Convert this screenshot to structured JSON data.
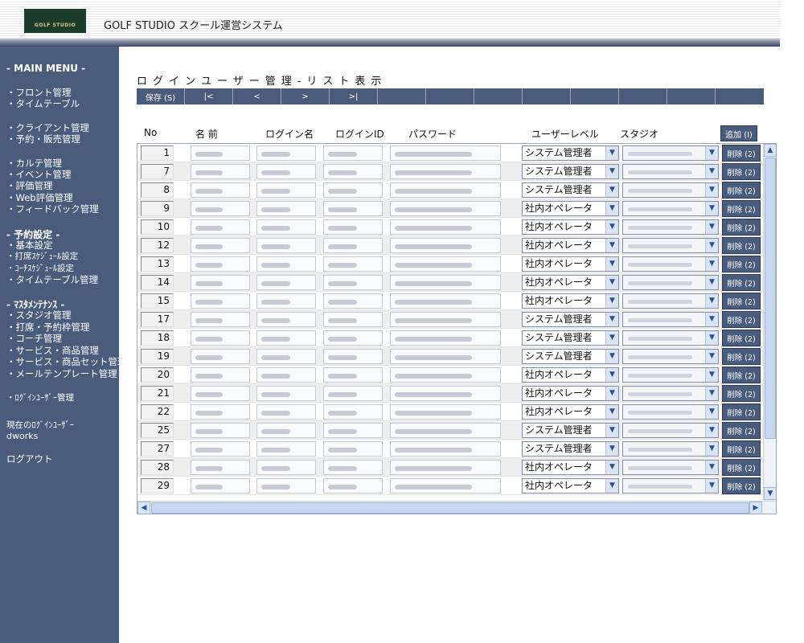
{
  "header": {
    "logo_text": "GOLF STUDIO",
    "app_title": "GOLF STUDIO スクール運営システム"
  },
  "sidebar": {
    "main_menu": "- MAIN MENU -",
    "group1": [
      "・フロント管理",
      "・タイムテーブル"
    ],
    "group2": [
      "・クライアント管理",
      "・予約・販売管理"
    ],
    "group3": [
      "・カルテ管理",
      "・イベント管理",
      "・評価管理",
      "・Web評価管理",
      "・フィードバック管理"
    ],
    "reserve_heading": "- 予約設定 -",
    "group4": [
      "・基本設定",
      "・打席ｽｹｼﾞｭｰﾙ設定",
      "・ｺｰﾁｽｹｼﾞｭｰﾙ設定",
      "・タイムテーブル管理"
    ],
    "master_heading": "- ﾏｽﾀﾒﾝﾃﾅﾝｽ -",
    "group5": [
      "・スタジオ管理",
      "・打席・予約枠管理",
      "・コーチ管理",
      "・サービス・商品管理",
      "・サービス・商品セット管理",
      "・メールテンプレート管理"
    ],
    "login_user_mgmt": "・ﾛｸﾞｲﾝﾕｰｻﾞｰ管理",
    "current_user_label": "現在のﾛｸﾞｲﾝﾕｰｻﾞｰ",
    "current_user": "dworks",
    "logout": "ログアウト"
  },
  "main": {
    "title": "ログインユーザー管理-リスト表示",
    "toolbar": {
      "save": "保存 (S)",
      "first": "|<",
      "prev": "<",
      "next": ">",
      "last": ">|"
    },
    "columns": {
      "no": "No",
      "name": "名 前",
      "login_name": "ログイン名",
      "login_id": "ログインID",
      "password": "パスワード",
      "user_level": "ユーザーレベル",
      "studio": "スタジオ"
    },
    "add_button": "追加 (I)",
    "delete_label": "削除 (2)",
    "rows": [
      {
        "no": "1",
        "level": "システム管理者"
      },
      {
        "no": "7",
        "level": "システム管理者"
      },
      {
        "no": "8",
        "level": "システム管理者"
      },
      {
        "no": "9",
        "level": "社内オペレータ"
      },
      {
        "no": "10",
        "level": "社内オペレータ"
      },
      {
        "no": "12",
        "level": "社内オペレータ"
      },
      {
        "no": "13",
        "level": "社内オペレータ"
      },
      {
        "no": "14",
        "level": "社内オペレータ"
      },
      {
        "no": "15",
        "level": "社内オペレータ"
      },
      {
        "no": "17",
        "level": "システム管理者"
      },
      {
        "no": "18",
        "level": "システム管理者"
      },
      {
        "no": "19",
        "level": "システム管理者"
      },
      {
        "no": "20",
        "level": "社内オペレータ"
      },
      {
        "no": "21",
        "level": "社内オペレータ"
      },
      {
        "no": "22",
        "level": "社内オペレータ"
      },
      {
        "no": "25",
        "level": "システム管理者"
      },
      {
        "no": "27",
        "level": "システム管理者"
      },
      {
        "no": "28",
        "level": "社内オペレータ"
      },
      {
        "no": "29",
        "level": "社内オペレータ"
      }
    ]
  },
  "colors": {
    "sidebar_bg": "#4a5c7c",
    "button_bg": "#4a5c7c",
    "logo_bg": "#1c3d2b"
  }
}
